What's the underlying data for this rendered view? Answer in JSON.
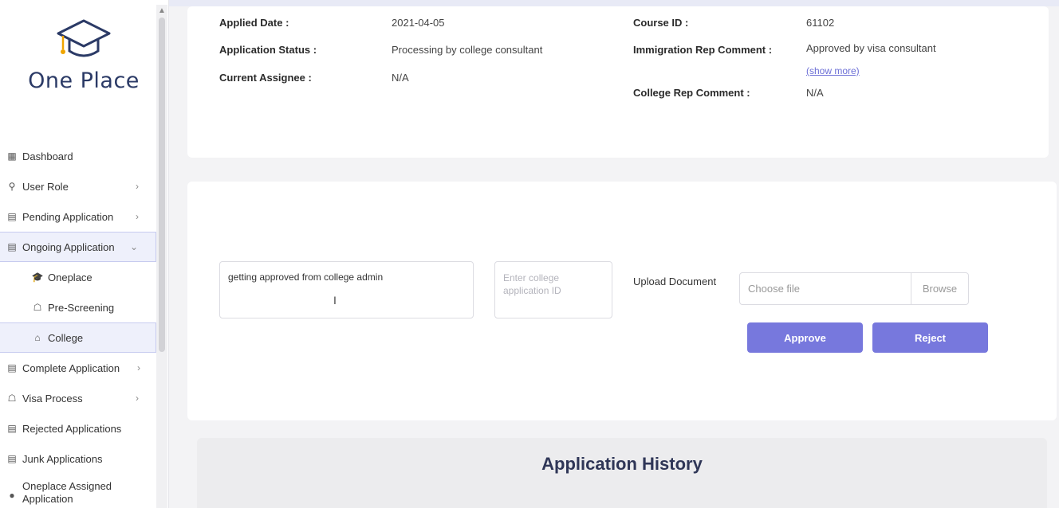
{
  "brand": {
    "name": "One Place"
  },
  "sidebar": {
    "items": [
      {
        "label": "Dashboard",
        "icon": "dashboard-icon"
      },
      {
        "label": "User Role",
        "icon": "users-icon",
        "chevron": ">"
      },
      {
        "label": "Pending Application",
        "icon": "document-icon",
        "chevron": ">"
      },
      {
        "label": "Ongoing Application",
        "icon": "document-icon",
        "chevron": "v"
      },
      {
        "label": "Oneplace",
        "icon": "graduation-cap-icon"
      },
      {
        "label": "Pre-Screening",
        "icon": "passenger-icon"
      },
      {
        "label": "College",
        "icon": "bank-icon"
      },
      {
        "label": "Complete Application",
        "icon": "document-icon",
        "chevron": ">"
      },
      {
        "label": "Visa Process",
        "icon": "passenger-icon",
        "chevron": ">"
      },
      {
        "label": "Rejected Applications",
        "icon": "document-icon"
      },
      {
        "label": "Junk Applications",
        "icon": "document-icon"
      },
      {
        "label": "Oneplace Assigned Application",
        "icon": "dot-icon"
      }
    ]
  },
  "details": {
    "applied_date_label": "Applied Date :",
    "applied_date": "2021-04-05",
    "status_label": "Application Status :",
    "status": "Processing by college consultant",
    "assignee_label": "Current Assignee :",
    "assignee": "N/A",
    "course_id_label": "Course ID :",
    "course_id": "61102",
    "immigration_label": "Immigration Rep Comment :",
    "immigration": "Approved by visa consultant",
    "show_more": "(show more)",
    "college_rep_label": "College Rep Comment :",
    "college_rep": "N/A"
  },
  "form": {
    "comment_value": "getting approved from college admin",
    "college_id_placeholder": "Enter college application ID",
    "upload_label": "Upload Document",
    "file_placeholder": "Choose file",
    "browse_label": "Browse",
    "approve_label": "Approve",
    "reject_label": "Reject"
  },
  "history": {
    "title": "Application History"
  },
  "colors": {
    "accent": "#7778dd",
    "brand": "#2b3a66",
    "logo_accent": "#f0a500"
  }
}
